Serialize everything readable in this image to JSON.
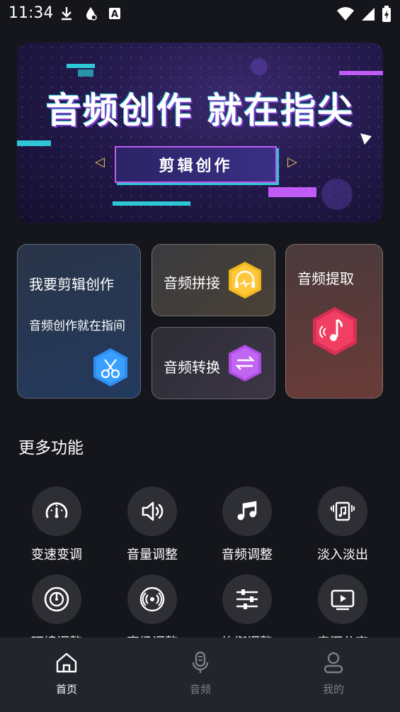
{
  "status_bar": {
    "time": "11:34",
    "left_icons": [
      "download-icon",
      "water-drop-icon",
      "font-a-icon"
    ],
    "right_icons": [
      "wifi-icon",
      "signal-icon",
      "battery-charging-icon"
    ]
  },
  "banner": {
    "headline": "音频创作 就在指尖",
    "button_label": "剪辑创作"
  },
  "cards": {
    "edit": {
      "title": "我要剪辑创作",
      "subtitle": "音频创作就在指间",
      "icon": "scissors-icon",
      "color": "#2f8cf0"
    },
    "splice": {
      "title": "音频拼接",
      "icon": "headphones-icon",
      "color": "#f2b51c"
    },
    "convert": {
      "title": "音频转换",
      "icon": "swap-arrows-icon",
      "color": "#b04ce6"
    },
    "extract": {
      "title": "音频提取",
      "icon": "music-note-icon",
      "color": "#f03f62"
    }
  },
  "more_functions": {
    "title": "更多功能",
    "items": [
      {
        "label": "变速变调",
        "icon": "speedometer-icon"
      },
      {
        "label": "音量调整",
        "icon": "volume-icon"
      },
      {
        "label": "音频调整",
        "icon": "music-notes-icon"
      },
      {
        "label": "淡入淡出",
        "icon": "music-file-icon"
      },
      {
        "label": "环境调整",
        "icon": "disc-icon"
      },
      {
        "label": "声场调整",
        "icon": "broadcast-icon"
      },
      {
        "label": "均衡调整",
        "icon": "equalizer-icon"
      },
      {
        "label": "音源分离",
        "icon": "video-play-icon"
      }
    ]
  },
  "bottom_nav": {
    "items": [
      {
        "label": "首页",
        "icon": "home-icon",
        "active": true
      },
      {
        "label": "音频",
        "icon": "microphone-icon",
        "active": false
      },
      {
        "label": "我的",
        "icon": "user-icon",
        "active": false
      }
    ],
    "active_color": "#ffffff",
    "inactive_color": "#7d7f86"
  }
}
